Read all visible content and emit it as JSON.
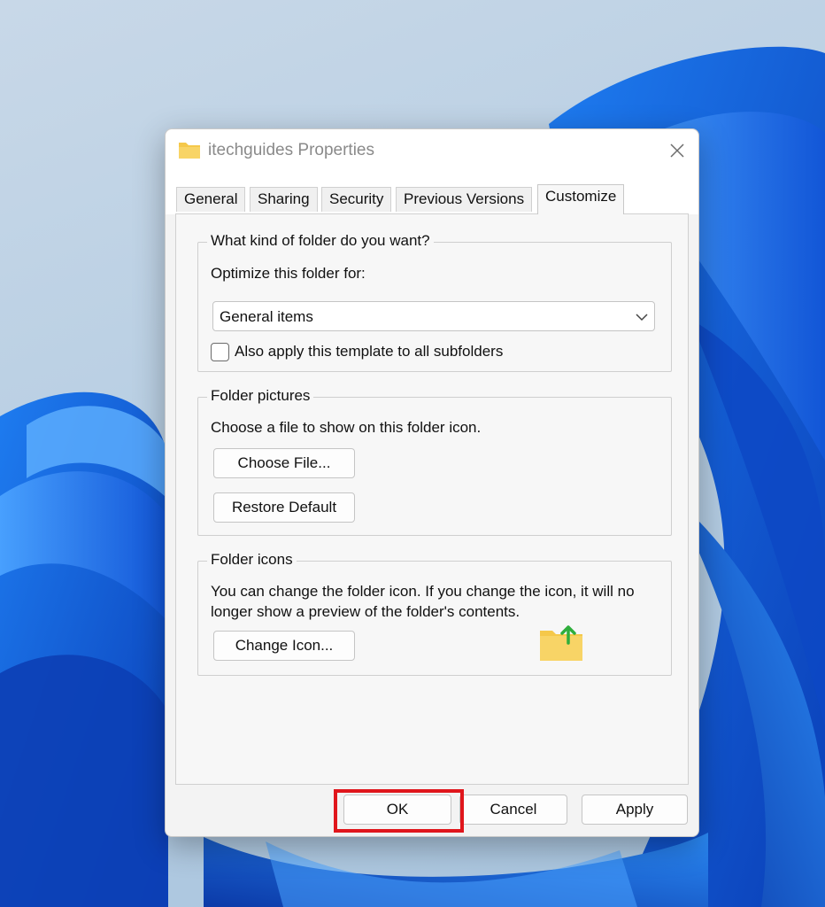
{
  "dialog": {
    "title": "itechguides Properties",
    "close_icon": "close-icon"
  },
  "tabs": [
    {
      "label": "General"
    },
    {
      "label": "Sharing"
    },
    {
      "label": "Security"
    },
    {
      "label": "Previous Versions"
    },
    {
      "label": "Customize",
      "active": true
    }
  ],
  "folder_type": {
    "heading": "What kind of folder do you want?",
    "optimize_label": "Optimize this folder for:",
    "selected": "General items",
    "apply_subfolders_label": "Also apply this template to all subfolders",
    "apply_subfolders_checked": false
  },
  "folder_pictures": {
    "heading": "Folder pictures",
    "description": "Choose a file to show on this folder icon.",
    "choose_file_label": "Choose File...",
    "restore_default_label": "Restore Default"
  },
  "folder_icons": {
    "heading": "Folder icons",
    "description": "You can change the folder icon. If you change the icon, it will no longer show a preview of the folder's contents.",
    "change_icon_label": "Change Icon...",
    "preview_icon": "folder-upload-icon"
  },
  "footer": {
    "ok_label": "OK",
    "cancel_label": "Cancel",
    "apply_label": "Apply"
  },
  "colors": {
    "highlight": "#e0161c",
    "folder": "#f5c84a",
    "arrow": "#2fae3c"
  }
}
